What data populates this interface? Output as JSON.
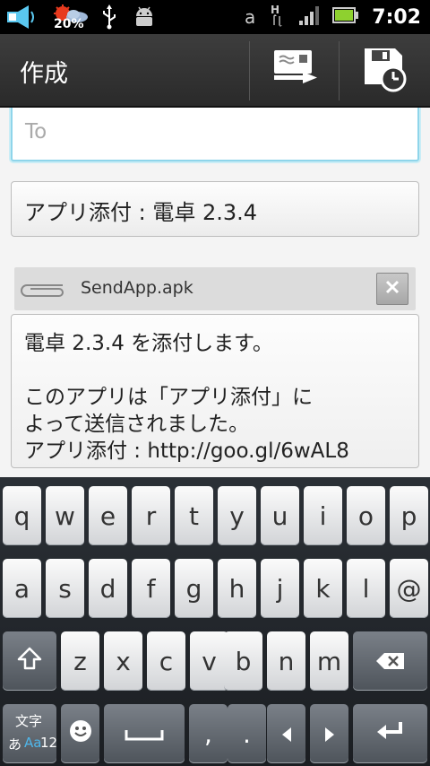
{
  "status_bar": {
    "battery_percent": "20%",
    "time": "7:02",
    "icons": [
      "speaker-icon",
      "weather-icon",
      "usb-icon",
      "android-debug-icon",
      "input-method-icon",
      "data-hspa-icon",
      "signal-icon",
      "battery-icon"
    ]
  },
  "action_bar": {
    "title": "作成",
    "buttons": [
      "send-icon",
      "save-draft-icon"
    ]
  },
  "compose": {
    "to_placeholder": "To",
    "subject": "アプリ添付 : 電卓 2.3.4",
    "attachment_name": "SendApp.apk",
    "body_lines": [
      "電卓 2.3.4 を添付します。",
      "",
      "このアプリは「アプリ添付」に",
      "よって送信されました。",
      "アプリ添付 : http://goo.gl/6wAL8"
    ]
  },
  "keyboard": {
    "row1": [
      "q",
      "w",
      "e",
      "r",
      "t",
      "y",
      "u",
      "i",
      "o",
      "p"
    ],
    "row2": [
      "a",
      "s",
      "d",
      "f",
      "g",
      "h",
      "j",
      "k",
      "l",
      "@"
    ],
    "row3": [
      "z",
      "x",
      "c",
      "v",
      "b",
      "n",
      "m"
    ],
    "mode_key": {
      "line1": "文字",
      "line2_a": "あ",
      "line2_b": "Aa",
      "line2_c": "12"
    },
    "comma": ",",
    "period": "."
  },
  "colors": {
    "focus_border": "#8fd5ea",
    "action_bar": "#333333",
    "keyboard_bg": "#23272c"
  }
}
